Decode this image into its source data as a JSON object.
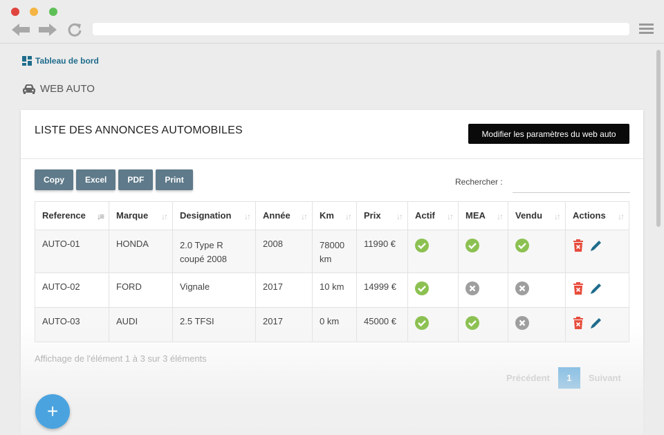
{
  "breadcrumb": {
    "label": "Tableau de bord",
    "icon": "dashboard-icon"
  },
  "page_title": {
    "label": "WEB AUTO",
    "icon": "car-icon"
  },
  "card": {
    "title": "LISTE DES ANNONCES AUTOMOBILES",
    "modify_button": "Modifier les paramètres du web auto"
  },
  "toolbar": {
    "copy": "Copy",
    "excel": "Excel",
    "pdf": "PDF",
    "print": "Print"
  },
  "search": {
    "label": "Rechercher :",
    "value": ""
  },
  "table": {
    "headers": [
      "Reference",
      "Marque",
      "Designation",
      "Année",
      "Km",
      "Prix",
      "Actif",
      "MEA",
      "Vendu",
      "Actions"
    ],
    "rows": [
      {
        "reference": "AUTO-01",
        "marque": "HONDA",
        "designation_line1": "2.0 Type R",
        "designation_line2": "coupé 2008",
        "annee": "2008",
        "km_line1": "78000",
        "km_line2": "km",
        "prix": "11990 €",
        "actif": "yes",
        "mea": "yes",
        "vendu": "yes"
      },
      {
        "reference": "AUTO-02",
        "marque": "FORD",
        "designation_line1": "Vignale",
        "designation_line2": "",
        "annee": "2017",
        "km_line1": "10 km",
        "km_line2": "",
        "prix": "14999 €",
        "actif": "yes",
        "mea": "no",
        "vendu": "no"
      },
      {
        "reference": "AUTO-03",
        "marque": "AUDI",
        "designation_line1": "2.5 TFSI",
        "designation_line2": "",
        "annee": "2017",
        "km_line1": "0 km",
        "km_line2": "",
        "prix": "45000 €",
        "actif": "yes",
        "mea": "yes",
        "vendu": "no"
      }
    ]
  },
  "info": "Affichage de l'élément 1 à 3 sur 3 éléments",
  "pagination": {
    "previous": "Précédent",
    "current": "1",
    "next": "Suivant"
  },
  "fab": "+",
  "colors": {
    "accent": "#1f6c8c",
    "tool_button": "#5f7a8a",
    "check": "#8cc152",
    "cross": "#9e9e9e",
    "delete": "#e74c3c",
    "edit": "#1f6c8c",
    "pager": "#4aa3df"
  }
}
